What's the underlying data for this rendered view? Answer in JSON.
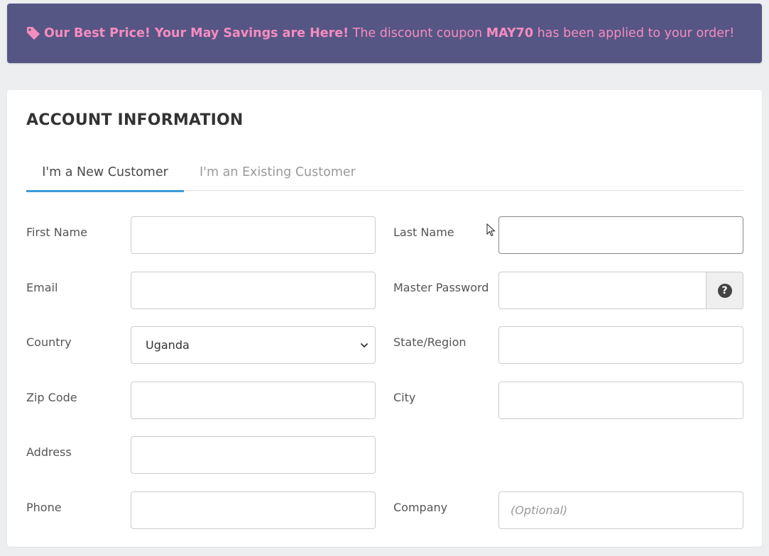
{
  "banner": {
    "headline": "Our Best Price! Your May Savings are Here!",
    "text_before": "The discount coupon",
    "coupon_code": "MAY70",
    "text_after": "has been applied to your order!",
    "icon": "tag-icon",
    "background_color": "#565685",
    "text_color": "#f58cc0"
  },
  "account": {
    "title": "ACCOUNT INFORMATION",
    "tabs": [
      {
        "label": "I'm a New Customer",
        "active": true
      },
      {
        "label": "I'm an Existing Customer",
        "active": false
      }
    ],
    "accent_color": "#3a9ad9",
    "fields": {
      "first_name": {
        "label": "First Name",
        "value": ""
      },
      "last_name": {
        "label": "Last Name",
        "value": ""
      },
      "email": {
        "label": "Email",
        "value": ""
      },
      "master_password": {
        "label": "Master Password",
        "value": "",
        "help_icon": "question-circle-icon"
      },
      "country": {
        "label": "Country",
        "value": "Uganda"
      },
      "state_region": {
        "label": "State/Region",
        "value": ""
      },
      "zip_code": {
        "label": "Zip Code",
        "value": ""
      },
      "city": {
        "label": "City",
        "value": ""
      },
      "address": {
        "label": "Address",
        "value": ""
      },
      "phone": {
        "label": "Phone",
        "value": ""
      },
      "company": {
        "label": "Company",
        "value": "",
        "placeholder": "(Optional)"
      }
    }
  }
}
